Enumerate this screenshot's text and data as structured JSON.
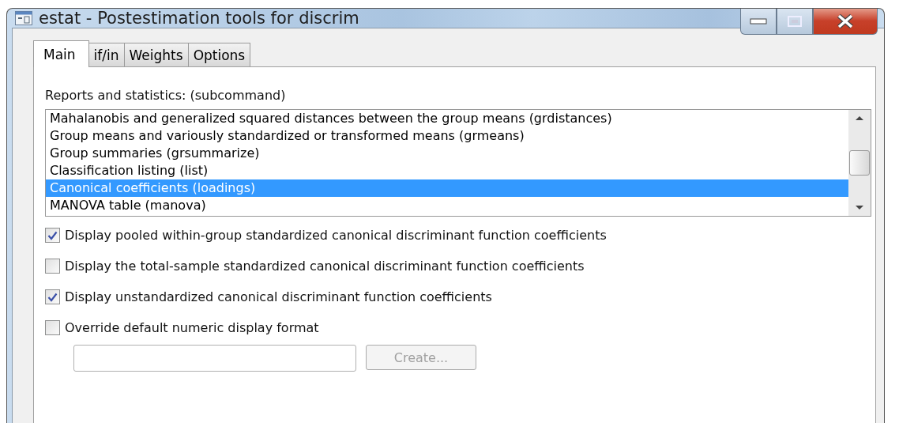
{
  "window": {
    "title": "estat - Postestimation tools for discrim"
  },
  "tabs": [
    {
      "label": "Main",
      "selected": true
    },
    {
      "label": "if/in",
      "selected": false
    },
    {
      "label": "Weights",
      "selected": false
    },
    {
      "label": "Options",
      "selected": false
    }
  ],
  "list_label": "Reports and statistics: (subcommand)",
  "list_items": [
    {
      "label": "Mahalanobis and generalized squared distances between the group means (grdistances)",
      "selected": false
    },
    {
      "label": "Group means and variously standardized or transformed means (grmeans)",
      "selected": false
    },
    {
      "label": "Group summaries (grsummarize)",
      "selected": false
    },
    {
      "label": "Classification listing (list)",
      "selected": false
    },
    {
      "label": "Canonical coefficients (loadings)",
      "selected": true
    },
    {
      "label": "MANOVA table (manova)",
      "selected": false
    }
  ],
  "options": [
    {
      "label": "Display pooled within-group standardized canonical discriminant function coefficients",
      "checked": true
    },
    {
      "label": "Display the total-sample standardized canonical discriminant function coefficients",
      "checked": false
    },
    {
      "label": "Display unstandardized canonical discriminant function coefficients",
      "checked": true
    },
    {
      "label": "Override default numeric display format",
      "checked": false
    }
  ],
  "format_button": {
    "label": "Create...",
    "disabled": true
  }
}
